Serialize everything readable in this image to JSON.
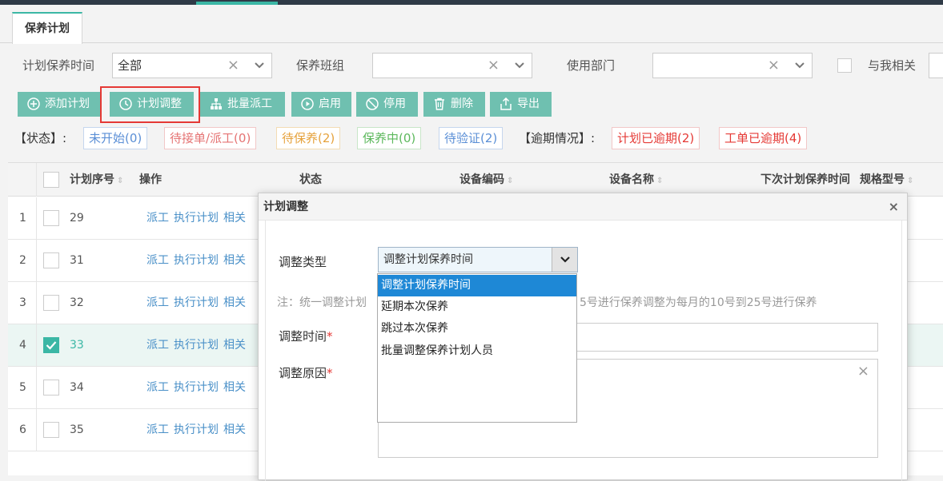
{
  "tab": {
    "label": "保养计划"
  },
  "filters": {
    "time_label": "计划保养时间",
    "time_value": "全部",
    "group_label": "保养班组",
    "dept_label": "使用部门",
    "mine_label": "与我相关",
    "clear_glyph": "×",
    "chevron_glyph": "⌄"
  },
  "toolbar": {
    "add": "添加计划",
    "adjust": "计划调整",
    "batch": "批量派工",
    "enable": "启用",
    "disable": "停用",
    "delete": "删除",
    "export": "导出"
  },
  "status": {
    "label": "【状态】:",
    "not_started": "未开始(0)",
    "waiting_dispatch": "待接单/派工(0)",
    "waiting_maint": "待保养(2)",
    "in_progress": "保养中(0)",
    "waiting_verify": "待验证(2)",
    "overdue_label": "【逾期情况】:",
    "plan_overdue": "计划已逾期(2)",
    "order_overdue": "工单已逾期(4)"
  },
  "colors": {
    "accent": "#3bb7a5",
    "button": "#6fc0b0",
    "link": "#4a90c8",
    "red": "#e53935",
    "orange": "#e6a23c",
    "green": "#5cb85c",
    "blue": "#5b8fd6"
  },
  "table": {
    "headers": {
      "seq": "计划序号",
      "ops": "操作",
      "status": "状态",
      "code": "设备编码",
      "name": "设备名称",
      "next": "下次计划保养时间",
      "spec": "规格型号"
    },
    "sort_glyph": "⇕",
    "ops_links": [
      "派工",
      "执行计划",
      "相关"
    ],
    "rows": [
      {
        "idx": "1",
        "seq": "29",
        "checked": false
      },
      {
        "idx": "2",
        "seq": "31",
        "checked": false
      },
      {
        "idx": "3",
        "seq": "32",
        "checked": false
      },
      {
        "idx": "4",
        "seq": "33",
        "checked": true
      },
      {
        "idx": "5",
        "seq": "34",
        "checked": false
      },
      {
        "idx": "6",
        "seq": "35",
        "checked": false
      }
    ]
  },
  "modal": {
    "title": "计划调整",
    "close": "×",
    "type_label": "调整类型",
    "type_value": "调整计划保养时间",
    "note_left": "注：统一调整计划",
    "note_right": "5号进行保养调整为每月的10号到25号进行保养",
    "time_label": "调整时间",
    "reason_label": "调整原因",
    "required_mark": "*",
    "clear": "×",
    "options": [
      "调整计划保养时间",
      "延期本次保养",
      "跳过本次保养",
      "批量调整保养计划人员"
    ]
  }
}
